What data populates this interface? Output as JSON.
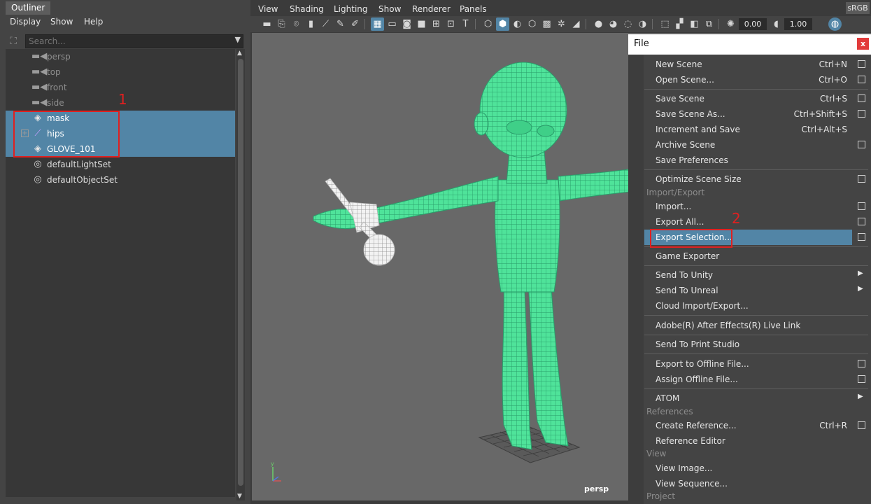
{
  "outliner": {
    "title": "Outliner",
    "menus": [
      "Display",
      "Show",
      "Help"
    ],
    "search_placeholder": "Search...",
    "items": [
      {
        "label": "persp",
        "kind": "camera"
      },
      {
        "label": "top",
        "kind": "camera"
      },
      {
        "label": "front",
        "kind": "camera"
      },
      {
        "label": "side",
        "kind": "camera"
      },
      {
        "label": "mask",
        "kind": "mesh",
        "selected": true
      },
      {
        "label": "hips",
        "kind": "joint",
        "selected": true
      },
      {
        "label": "GLOVE_101",
        "kind": "mesh",
        "selected": true
      },
      {
        "label": "defaultLightSet",
        "kind": "set"
      },
      {
        "label": "defaultObjectSet",
        "kind": "set"
      }
    ],
    "callout_number": "1"
  },
  "viewport": {
    "menus": [
      "View",
      "Shading",
      "Lighting",
      "Show",
      "Renderer",
      "Panels"
    ],
    "exposure": "0.00",
    "gamma": "1.00",
    "color_space": "sRGB",
    "camera_label": "persp"
  },
  "file_menu": {
    "title": "File",
    "close_glyph": "x",
    "callout_number": "2",
    "items": {
      "new_scene": {
        "label": "New Scene",
        "shortcut": "Ctrl+N"
      },
      "open_scene": {
        "label": "Open Scene...",
        "shortcut": "Ctrl+O"
      },
      "save_scene": {
        "label": "Save Scene",
        "shortcut": "Ctrl+S"
      },
      "save_scene_as": {
        "label": "Save Scene As...",
        "shortcut": "Ctrl+Shift+S"
      },
      "increment_save": {
        "label": "Increment and Save",
        "shortcut": "Ctrl+Alt+S"
      },
      "archive_scene": {
        "label": "Archive Scene"
      },
      "save_preferences": {
        "label": "Save Preferences"
      },
      "optimize_scene": {
        "label": "Optimize Scene Size"
      },
      "import": {
        "label": "Import..."
      },
      "export_all": {
        "label": "Export All..."
      },
      "export_selection": {
        "label": "Export Selection..."
      },
      "game_exporter": {
        "label": "Game Exporter"
      },
      "send_to_unity": {
        "label": "Send To Unity"
      },
      "send_to_unreal": {
        "label": "Send To Unreal"
      },
      "cloud_import_export": {
        "label": "Cloud Import/Export..."
      },
      "after_effects": {
        "label": "Adobe(R) After Effects(R) Live Link"
      },
      "print_studio": {
        "label": "Send To Print Studio"
      },
      "export_offline": {
        "label": "Export to Offline File..."
      },
      "assign_offline": {
        "label": "Assign Offline File..."
      },
      "atom": {
        "label": "ATOM"
      },
      "create_reference": {
        "label": "Create Reference...",
        "shortcut": "Ctrl+R"
      },
      "reference_editor": {
        "label": "Reference Editor"
      },
      "view_image": {
        "label": "View Image..."
      },
      "view_sequence": {
        "label": "View Sequence..."
      }
    },
    "sections": {
      "import_export": "Import/Export",
      "references": "References",
      "view": "View",
      "project": "Project"
    }
  },
  "colors": {
    "selection": "#5285a6",
    "mesh_wire": "#5cf2a6",
    "callout": "#e02020"
  }
}
